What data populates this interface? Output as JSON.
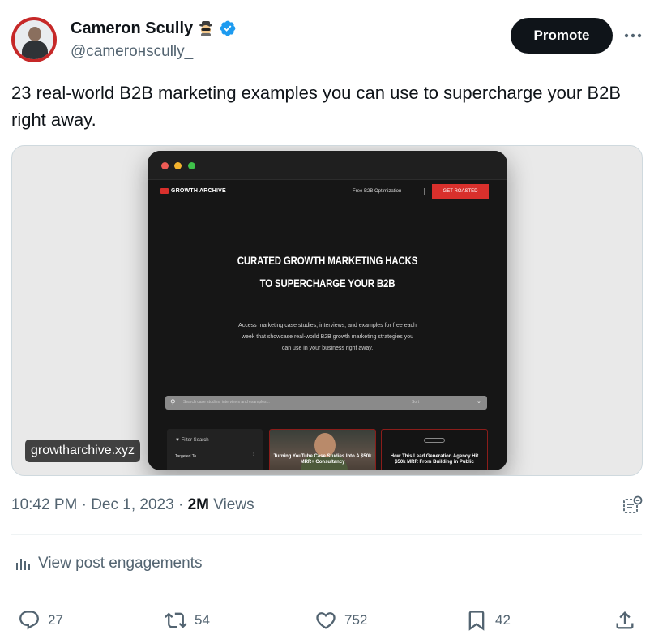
{
  "author": {
    "name": "Cameron Scully",
    "handle": "@camerонscully_"
  },
  "post": {
    "text": "23 real-world B2B marketing examples you can use to supercharge your B2B right away.",
    "time_date": "10:42 PM · Dec 1, 2023 · ",
    "views_count": "2M",
    "views_label": " Views"
  },
  "header": {
    "promote_label": "Promote"
  },
  "media": {
    "caption": "growtharchive.xyz",
    "site": {
      "logo_text": "GROWTH ARCHIVE",
      "nav_link": "Free B2B Optimization",
      "nav_cta": "GET ROASTED",
      "hero_line1": "CURATED GROWTH MARKETING HACKS",
      "hero_line2": "TO SUPERCHARGE YOUR B2B",
      "hero_sub": "Access marketing case studies, interviews, and examples for free each week that showcase real-world B2B growth marketing strategies you can use in your business right away.",
      "search_placeholder": "Search case studies, interviews and examples...",
      "search_sort": "Sort",
      "filter_title": "Filter Search",
      "filter_item": "Targeted To",
      "case1_title": "Turning YouTube Case Studies Into A $50k MRR+ Consultancy",
      "case2_title": "How This Lead Generation Agency Hit $50k MRR From Building in Public"
    }
  },
  "engagements_label": "View post engagements",
  "actions": {
    "replies": "27",
    "reposts": "54",
    "likes": "752",
    "bookmarks": "42"
  },
  "colors": {
    "text_primary": "#0f1419",
    "text_secondary": "#536471",
    "verified": "#1d9bf0",
    "avatar_ring": "#c62828",
    "site_accent": "#d9302c"
  },
  "icons": [
    "spy-emoji-icon",
    "verified-badge-icon",
    "more-icon",
    "grok-analyze-icon",
    "analytics-icon",
    "reply-icon",
    "repost-icon",
    "like-icon",
    "bookmark-icon",
    "share-icon"
  ]
}
